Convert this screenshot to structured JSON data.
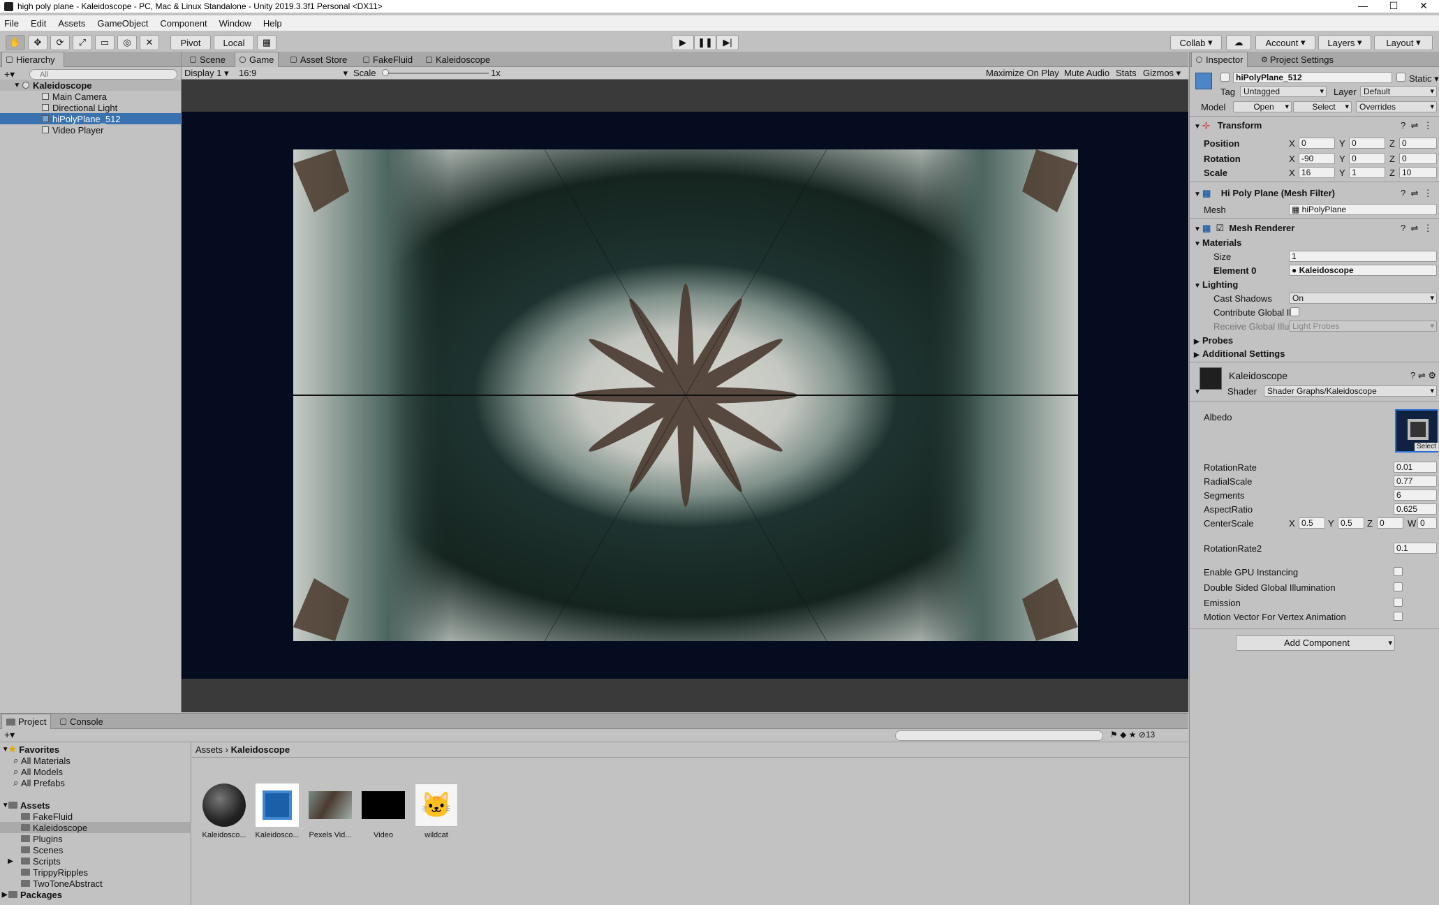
{
  "window": {
    "title": "high poly plane - Kaleidoscope - PC, Mac & Linux Standalone - Unity 2019.3.3f1 Personal <DX11>"
  },
  "menu": [
    "File",
    "Edit",
    "Assets",
    "GameObject",
    "Component",
    "Window",
    "Help"
  ],
  "toolbar": {
    "pivot": "Pivot",
    "local": "Local",
    "collab": "Collab",
    "account": "Account",
    "layers": "Layers",
    "layout": "Layout"
  },
  "hierarchy": {
    "tab": "Hierarchy",
    "search_placeholder": "All",
    "scene": "Kaleidoscope",
    "items": [
      "Main Camera",
      "Directional Light",
      "hiPolyPlane_512",
      "Video Player"
    ]
  },
  "center_tabs": [
    "Scene",
    "Game",
    "Asset Store",
    "FakeFluid",
    "Kaleidoscope"
  ],
  "game": {
    "display": "Display 1",
    "aspect": "16:9",
    "scale_label": "Scale",
    "scale_value": "1x",
    "maximize": "Maximize On Play",
    "mute": "Mute Audio",
    "stats": "Stats",
    "gizmos": "Gizmos"
  },
  "inspector": {
    "tabs": [
      "Inspector",
      "Project Settings"
    ],
    "object_name": "hiPolyPlane_512",
    "static": "Static",
    "tag_label": "Tag",
    "tag_value": "Untagged",
    "layer_label": "Layer",
    "layer_value": "Default",
    "model_label": "Model",
    "open": "Open",
    "select": "Select",
    "overrides": "Overrides",
    "transform": {
      "title": "Transform",
      "position": {
        "label": "Position",
        "x": "0",
        "y": "0",
        "z": "0"
      },
      "rotation": {
        "label": "Rotation",
        "x": "-90",
        "y": "0",
        "z": "0"
      },
      "scale": {
        "label": "Scale",
        "x": "16",
        "y": "1",
        "z": "10"
      }
    },
    "mesh_filter": {
      "title": "Hi Poly Plane (Mesh Filter)",
      "mesh_label": "Mesh",
      "mesh_value": "hiPolyPlane"
    },
    "mesh_renderer": {
      "title": "Mesh Renderer",
      "materials": "Materials",
      "size_label": "Size",
      "size_value": "1",
      "element_label": "Element 0",
      "element_value": "Kaleidoscope",
      "lighting": "Lighting",
      "cast_shadows_label": "Cast Shadows",
      "cast_shadows_value": "On",
      "contribute_gi": "Contribute Global Il",
      "receive_gi": "Receive Global Illui",
      "receive_gi_value": "Light Probes",
      "probes": "Probes",
      "additional": "Additional Settings"
    },
    "material": {
      "name": "Kaleidoscope",
      "shader_label": "Shader",
      "shader_value": "Shader Graphs/Kaleidoscope",
      "albedo": "Albedo",
      "select": "Select",
      "props": [
        {
          "label": "RotationRate",
          "value": "0.01"
        },
        {
          "label": "RadialScale",
          "value": "0.77"
        },
        {
          "label": "Segments",
          "value": "6"
        },
        {
          "label": "AspectRatio",
          "value": "0.625"
        }
      ],
      "center_scale": {
        "label": "CenterScale",
        "x": "0.5",
        "y": "0.5",
        "z": "0",
        "w": "0"
      },
      "rotation_rate2": {
        "label": "RotationRate2",
        "value": "0.1"
      },
      "flags": [
        "Enable GPU Instancing",
        "Double Sided Global Illumination",
        "Emission",
        "Motion Vector For Vertex Animation"
      ]
    },
    "add_component": "Add Component"
  },
  "project": {
    "tabs": [
      "Project",
      "Console"
    ],
    "count": "13",
    "favorites": "Favorites",
    "fav_items": [
      "All Materials",
      "All Models",
      "All Prefabs"
    ],
    "assets": "Assets",
    "folders": [
      "FakeFluid",
      "Kaleidoscope",
      "Plugins",
      "Scenes",
      "Scripts",
      "TrippyRipples",
      "TwoToneAbstract"
    ],
    "packages": "Packages",
    "breadcrumb": [
      "Assets",
      "Kaleidoscope"
    ],
    "grid": [
      "Kaleidosco...",
      "Kaleidosco...",
      "Pexels Vid...",
      "Video",
      "wildcat"
    ]
  },
  "colors": {
    "selection": "#3a72b0",
    "panel": "#c2c2c2",
    "game_bg": "#050c1f"
  }
}
